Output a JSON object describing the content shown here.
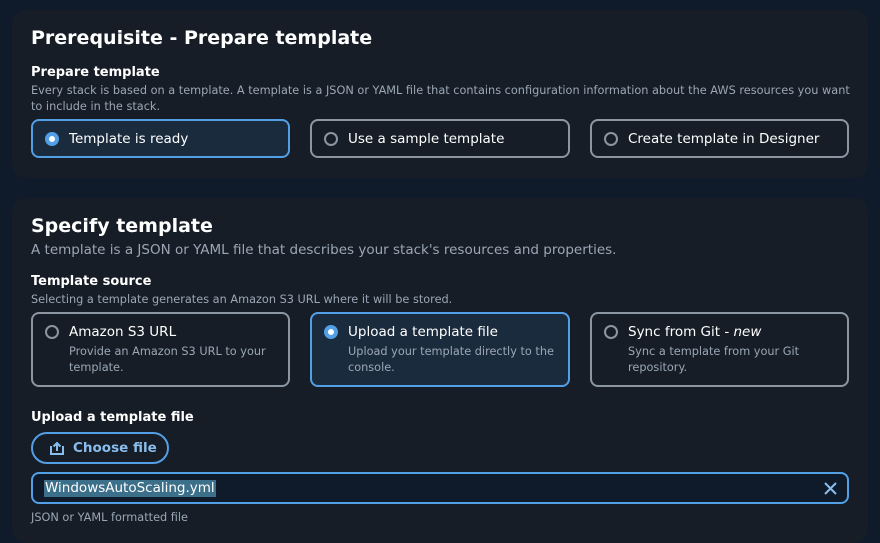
{
  "prerequisite": {
    "title": "Prerequisite - Prepare template",
    "field_label": "Prepare template",
    "description": "Every stack is based on a template. A template is a JSON or YAML file that contains configuration information about the AWS resources you want to include in the stack.",
    "options": [
      {
        "label": "Template is ready",
        "selected": true
      },
      {
        "label": "Use a sample template",
        "selected": false
      },
      {
        "label": "Create template in Designer",
        "selected": false
      }
    ]
  },
  "specify": {
    "title": "Specify template",
    "subtitle": "A template is a JSON or YAML file that describes your stack's resources and properties.",
    "source_label": "Template source",
    "source_description": "Selecting a template generates an Amazon S3 URL where it will be stored.",
    "sources": [
      {
        "label": "Amazon S3 URL",
        "description": "Provide an Amazon S3 URL to your template.",
        "selected": false
      },
      {
        "label": "Upload a template file",
        "description": "Upload your template directly to the console.",
        "selected": true
      },
      {
        "label": "Sync from Git - ",
        "label_suffix": "new",
        "description": "Sync a template from your Git repository.",
        "selected": false
      }
    ],
    "upload_label": "Upload a template file",
    "choose_file_label": "Choose file",
    "file_value": "WindowsAutoScaling.yml",
    "file_hint": "JSON or YAML formatted file"
  },
  "colors": {
    "accent": "#539fe5",
    "background": "#0f1b2a",
    "card": "#161d26",
    "selected_tile": "#1b2b3e"
  },
  "icons": {
    "upload": "upload-icon",
    "clear": "close-icon"
  }
}
